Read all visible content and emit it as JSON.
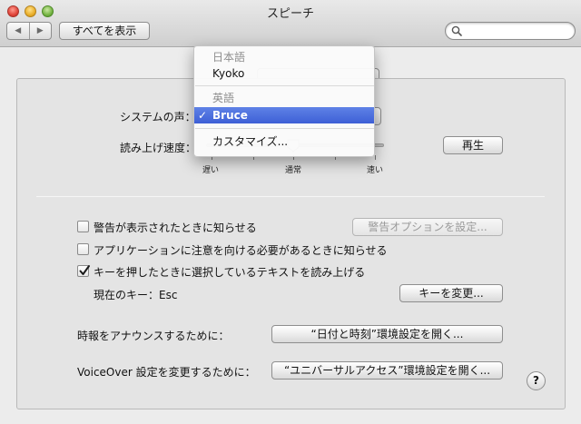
{
  "window": {
    "title": "スピーチ"
  },
  "toolbar": {
    "show_all_label": "すべてを表示",
    "back_glyph": "◀",
    "forward_glyph": "▶"
  },
  "voice": {
    "system_voice_label": "システムの声：",
    "rate_label": "読み上げ速度：",
    "play_button": "再生",
    "slow_label": "遅い",
    "normal_label": "通常",
    "fast_label": "速い"
  },
  "dropdown": {
    "group_japanese": "日本語",
    "voice_kyoko": "Kyoko",
    "group_english": "英語",
    "voice_bruce": "Bruce",
    "customize": "カスタマイズ...",
    "selected": "Bruce"
  },
  "options": {
    "alert_label": "警告が表示されたときに知らせる",
    "alert_checked": false,
    "alert_options_button": "警告オプションを設定...",
    "app_attention_label": "アプリケーションに注意を向ける必要があるときに知らせる",
    "app_attention_checked": false,
    "speak_selection_label": "キーを押したときに選択しているテキストを読み上げる",
    "speak_selection_checked": true,
    "current_key_label": "現在のキー：Esc",
    "change_key_button": "キーを変更..."
  },
  "announce": {
    "time_label": "時報をアナウンスするために：",
    "time_button": "“日付と時刻”環境設定を開く...",
    "voiceover_label": "VoiceOver 設定を変更するために：",
    "voiceover_button": "“ユニバーサルアクセス”環境設定を開く..."
  },
  "help": {
    "glyph": "?"
  },
  "colors": {
    "menu_highlight": "#3d5fd6",
    "close": "#e0443a",
    "minimize": "#e9ae2a",
    "zoom": "#75b443"
  },
  "icons": [
    "search-icon",
    "checkmark-icon",
    "help-icon"
  ]
}
